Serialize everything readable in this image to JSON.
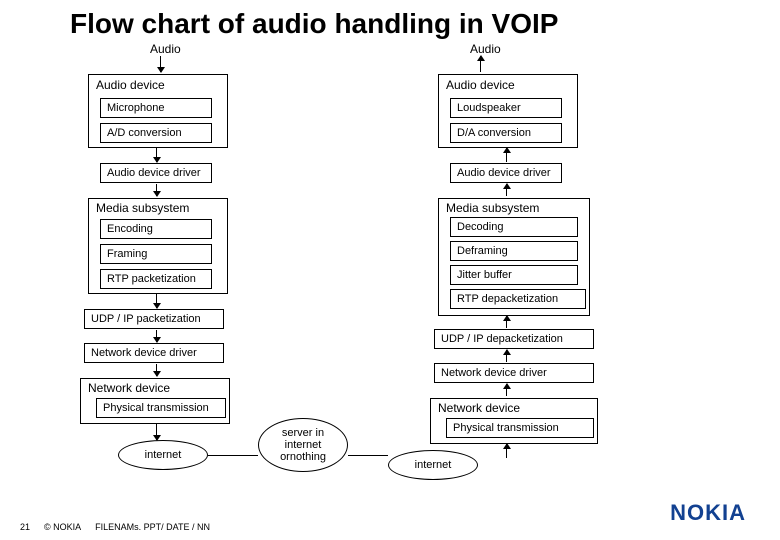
{
  "title": "Flow chart of audio handling in VOIP",
  "left": {
    "audio": "Audio",
    "device_group": "Audio device",
    "mic": "Microphone",
    "adc": "A/D conversion",
    "driver": "Audio device driver",
    "media_group": "Media subsystem",
    "encoding": "Encoding",
    "framing": "Framing",
    "rtp": "RTP packetization",
    "udp": "UDP / IP packetization",
    "netdriver": "Network device driver",
    "netdevice_group": "Network device",
    "phys": "Physical transmission",
    "internet": "internet"
  },
  "right": {
    "audio": "Audio",
    "device_group": "Audio device",
    "speaker": "Loudspeaker",
    "dac": "D/A conversion",
    "driver": "Audio device driver",
    "media_group": "Media subsystem",
    "decoding": "Decoding",
    "deframing": "Deframing",
    "jitter": "Jitter buffer",
    "rtpd": "RTP depacketization",
    "udp": "UDP / IP depacketization",
    "netdriver": "Network device driver",
    "netdevice_group": "Network device",
    "phys": "Physical transmission",
    "internet": "internet"
  },
  "center_cloud": "server in internet ornothing",
  "footer": {
    "page": "21",
    "copyright": "© NOKIA",
    "filename": "FILENAMs. PPT/ DATE / NN"
  },
  "logo": "NOKIA"
}
